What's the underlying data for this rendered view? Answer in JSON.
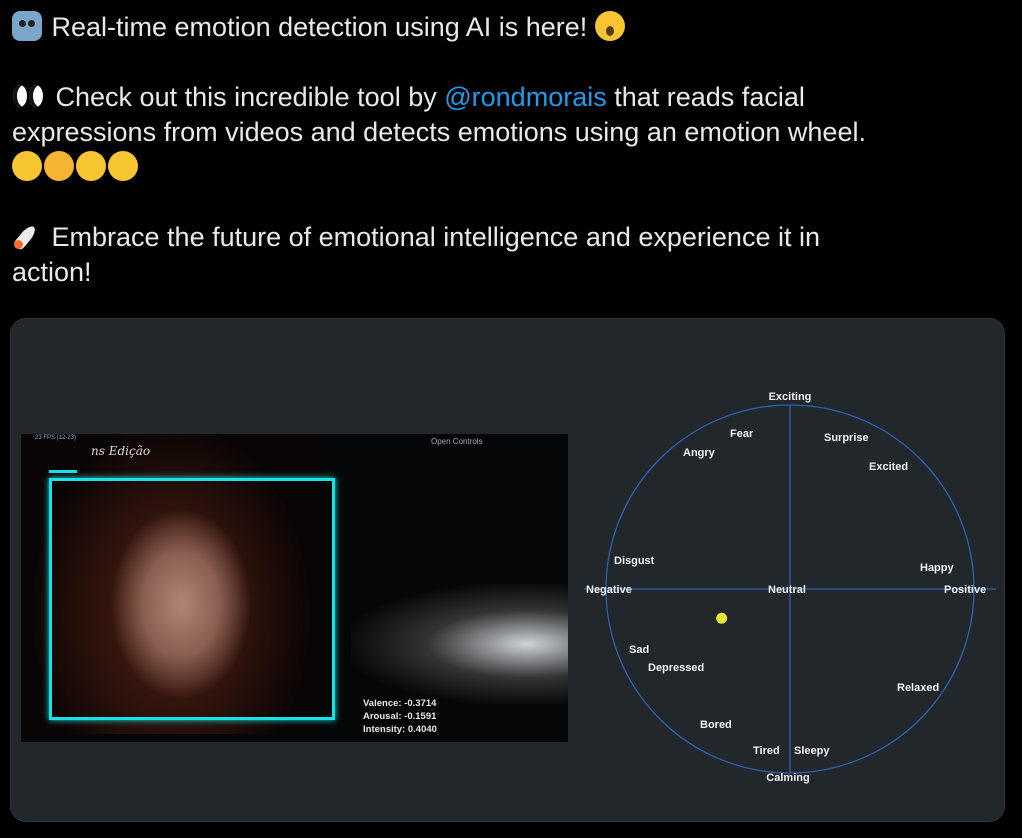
{
  "tweet": {
    "line1": "Real-time emotion detection using AI is here!",
    "line2_before": "Check out this incredible tool by",
    "mention": "@rondmorais",
    "line2_after": "that reads facial",
    "line3": "expressions from videos and detects emotions using an emotion wheel.",
    "line5": "Embrace the future of emotional intelligence and experience it in",
    "line6": "action!",
    "emojis": [
      "robot-face",
      "face-with-open-mouth",
      "eyes",
      "smiling-face-with-heart-eyes",
      "angry-face",
      "crying-face",
      "face-with-tears-of-joy",
      "rocket"
    ]
  },
  "video": {
    "fps_text": "23 FPS (12-23)",
    "brand_text": "ns Edição",
    "open_controls": "Open Controls",
    "valence": "Valence: -0.3714",
    "arousal": "Arousal: -0.1591",
    "intensity": "Intensity: 0.4040",
    "box_color": "#19e1e6"
  },
  "wheel": {
    "axis_top": "Exciting",
    "axis_bottom": "Calming",
    "axis_left": "Negative",
    "axis_right": "Positive",
    "center": "Neutral",
    "emotions": [
      "Fear",
      "Surprise",
      "Angry",
      "Excited",
      "Disgust",
      "Happy",
      "Sad",
      "Depressed",
      "Relaxed",
      "Bored",
      "Tired",
      "Sleepy"
    ],
    "point": {
      "valence": -0.3714,
      "arousal": -0.1591
    },
    "colors": {
      "circle": "#2f5fb3",
      "top": "#e8741e",
      "bottom": "#1e6fd9",
      "left": "#d01a1a",
      "right": "#22c55e",
      "point": "#e6e632"
    }
  }
}
